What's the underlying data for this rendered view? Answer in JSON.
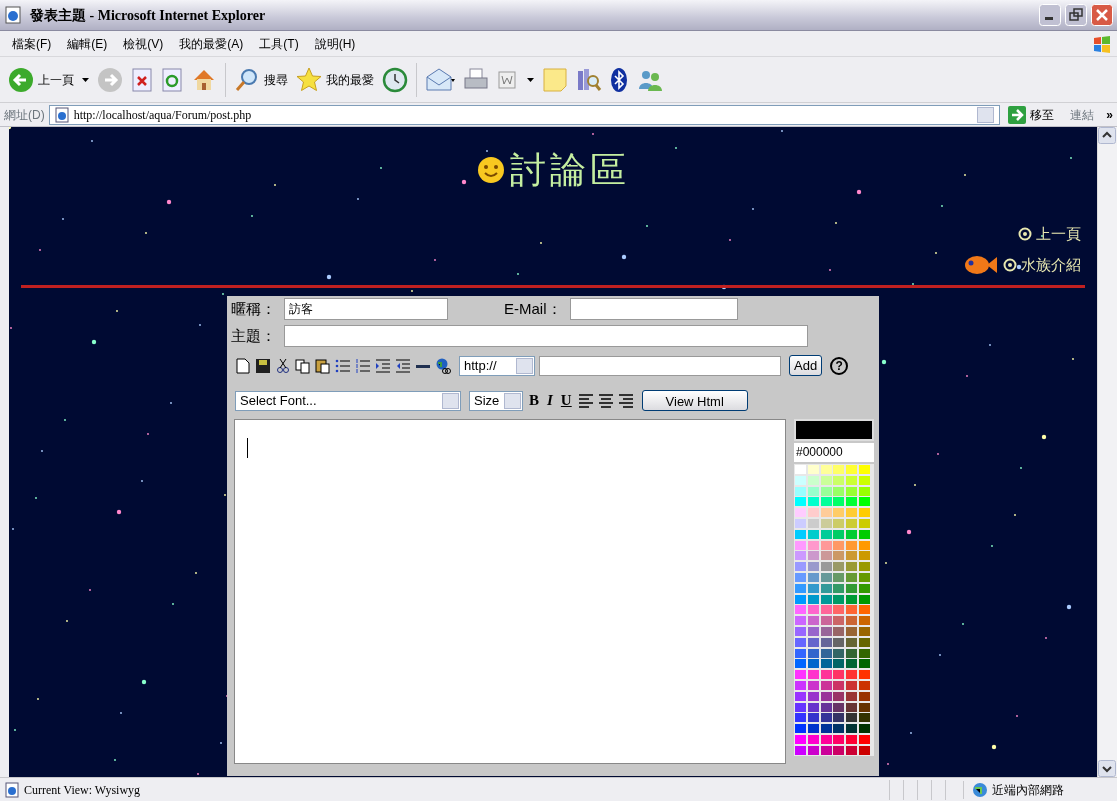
{
  "window": {
    "title": "發表主題 - Microsoft Internet Explorer"
  },
  "menu": [
    "檔案(F)",
    "編輯(E)",
    "檢視(V)",
    "我的最愛(A)",
    "工具(T)",
    "說明(H)"
  ],
  "toolbar": {
    "back": "上一頁",
    "search": "搜尋",
    "favorites": "我的最愛"
  },
  "address_bar": {
    "label": "網址(D)",
    "url": "http://localhost/aqua/Forum/post.php",
    "go": "移至",
    "links": "連結",
    "more": "»"
  },
  "page": {
    "title": "討論區",
    "links": [
      "上一頁",
      "水族介紹"
    ],
    "form": {
      "nickname_label": "暱稱：",
      "nickname": "訪客",
      "email_label": "E-Mail：",
      "subject_label": "主題：",
      "protocol": "http://",
      "add_button": "Add",
      "help": "?",
      "font_select": "Select Font...",
      "size_select": "Size",
      "format_buttons": [
        "B",
        "I",
        "U"
      ],
      "view_html": "View Html",
      "color_value": "#000000",
      "palette": [
        {
          "color": "#ffffff"
        },
        {
          "color": "#ffffcc"
        },
        {
          "color": "#ffff99"
        },
        {
          "color": "#ffff66"
        },
        {
          "color": "#ffff33"
        },
        {
          "color": "#ffff00"
        },
        {
          "color": "#ccffff"
        },
        {
          "color": "#ccffcc"
        },
        {
          "color": "#ccff99"
        },
        {
          "color": "#ccff66"
        },
        {
          "color": "#ccff33"
        },
        {
          "color": "#ccff00"
        },
        {
          "color": "#99ffff"
        },
        {
          "color": "#99ffcc"
        },
        {
          "color": "#99ff99"
        },
        {
          "color": "#99ff66"
        },
        {
          "color": "#99ff33"
        },
        {
          "color": "#99ff00"
        },
        {
          "color": "#00ffff"
        },
        {
          "color": "#00ffcc"
        },
        {
          "color": "#00ff99"
        },
        {
          "color": "#00ff66"
        },
        {
          "color": "#00ff33"
        },
        {
          "color": "#00ff00"
        },
        {
          "color": "#ffccff"
        },
        {
          "color": "#ffcccc"
        },
        {
          "color": "#ffcc99"
        },
        {
          "color": "#ffcc66"
        },
        {
          "color": "#ffcc33"
        },
        {
          "color": "#ffcc00"
        },
        {
          "color": "#ccccff"
        },
        {
          "color": "#cccccc"
        },
        {
          "color": "#cccc99"
        },
        {
          "color": "#cccc66"
        },
        {
          "color": "#cccc33"
        },
        {
          "color": "#cccc00"
        },
        {
          "color": "#00ccff"
        },
        {
          "color": "#00cccc"
        },
        {
          "color": "#00cc99"
        },
        {
          "color": "#00cc66"
        },
        {
          "color": "#00cc33"
        },
        {
          "color": "#00cc00"
        },
        {
          "color": "#ff99ff"
        },
        {
          "color": "#ff99cc"
        },
        {
          "color": "#ff9999"
        },
        {
          "color": "#ff9966"
        },
        {
          "color": "#ff9933"
        },
        {
          "color": "#ff9900"
        },
        {
          "color": "#cc99ff"
        },
        {
          "color": "#cc99cc"
        },
        {
          "color": "#cc9999"
        },
        {
          "color": "#cc9966"
        },
        {
          "color": "#cc9933"
        },
        {
          "color": "#cc9900"
        },
        {
          "color": "#9999ff"
        },
        {
          "color": "#9999cc"
        },
        {
          "color": "#999999"
        },
        {
          "color": "#999966"
        },
        {
          "color": "#999933"
        },
        {
          "color": "#999900"
        },
        {
          "color": "#6699ff"
        },
        {
          "color": "#6699cc"
        },
        {
          "color": "#669999"
        },
        {
          "color": "#669966"
        },
        {
          "color": "#669933"
        },
        {
          "color": "#669900"
        },
        {
          "color": "#3399ff"
        },
        {
          "color": "#3399cc"
        },
        {
          "color": "#339999"
        },
        {
          "color": "#339966"
        },
        {
          "color": "#339933"
        },
        {
          "color": "#339900"
        },
        {
          "color": "#0099ff"
        },
        {
          "color": "#0099cc"
        },
        {
          "color": "#009999"
        },
        {
          "color": "#009966"
        },
        {
          "color": "#009933"
        },
        {
          "color": "#009900"
        },
        {
          "color": "#ff66ff"
        },
        {
          "color": "#ff66cc"
        },
        {
          "color": "#ff6699"
        },
        {
          "color": "#ff6666"
        },
        {
          "color": "#ff6633"
        },
        {
          "color": "#ff6600"
        },
        {
          "color": "#cc66ff"
        },
        {
          "color": "#cc66cc"
        },
        {
          "color": "#cc6699"
        },
        {
          "color": "#cc6666"
        },
        {
          "color": "#cc6633"
        },
        {
          "color": "#cc6600"
        },
        {
          "color": "#9966ff"
        },
        {
          "color": "#9966cc"
        },
        {
          "color": "#996699"
        },
        {
          "color": "#996666"
        },
        {
          "color": "#996633"
        },
        {
          "color": "#996600"
        },
        {
          "color": "#6666ff"
        },
        {
          "color": "#6666cc"
        },
        {
          "color": "#666699"
        },
        {
          "color": "#666666"
        },
        {
          "color": "#666633"
        },
        {
          "color": "#666600"
        },
        {
          "color": "#3366ff"
        },
        {
          "color": "#3366cc"
        },
        {
          "color": "#336699"
        },
        {
          "color": "#336666"
        },
        {
          "color": "#336633"
        },
        {
          "color": "#336600"
        },
        {
          "color": "#0066ff"
        },
        {
          "color": "#0066cc"
        },
        {
          "color": "#006699"
        },
        {
          "color": "#006666"
        },
        {
          "color": "#006633"
        },
        {
          "color": "#006600"
        },
        {
          "color": "#ff33ff"
        },
        {
          "color": "#ff33cc"
        },
        {
          "color": "#ff3399"
        },
        {
          "color": "#ff3366"
        },
        {
          "color": "#ff3333"
        },
        {
          "color": "#ff3300"
        },
        {
          "color": "#cc33ff"
        },
        {
          "color": "#cc33cc"
        },
        {
          "color": "#cc3399"
        },
        {
          "color": "#cc3366"
        },
        {
          "color": "#cc3333"
        },
        {
          "color": "#cc3300"
        },
        {
          "color": "#9933ff"
        },
        {
          "color": "#9933cc"
        },
        {
          "color": "#993399"
        },
        {
          "color": "#993366"
        },
        {
          "color": "#993333"
        },
        {
          "color": "#993300"
        },
        {
          "color": "#6633ff"
        },
        {
          "color": "#6633cc"
        },
        {
          "color": "#663399"
        },
        {
          "color": "#663366"
        },
        {
          "color": "#663333"
        },
        {
          "color": "#663300"
        },
        {
          "color": "#3333ff"
        },
        {
          "color": "#3333cc"
        },
        {
          "color": "#333399"
        },
        {
          "color": "#333366"
        },
        {
          "color": "#333333"
        },
        {
          "color": "#333300"
        },
        {
          "color": "#0033ff"
        },
        {
          "color": "#0033cc"
        },
        {
          "color": "#003399"
        },
        {
          "color": "#003366"
        },
        {
          "color": "#003333"
        },
        {
          "color": "#003300"
        },
        {
          "color": "#ff00ff"
        },
        {
          "color": "#ff00cc"
        },
        {
          "color": "#ff0099"
        },
        {
          "color": "#ff0066"
        },
        {
          "color": "#ff0033"
        },
        {
          "color": "#ff0000"
        },
        {
          "color": "#cc00ff"
        },
        {
          "color": "#cc00cc"
        },
        {
          "color": "#cc0099"
        },
        {
          "color": "#cc0066"
        },
        {
          "color": "#cc0033"
        },
        {
          "color": "#cc0000"
        }
      ]
    }
  },
  "status_bar": {
    "text": "Current View: Wysiwyg",
    "zone": "近端內部網路"
  }
}
